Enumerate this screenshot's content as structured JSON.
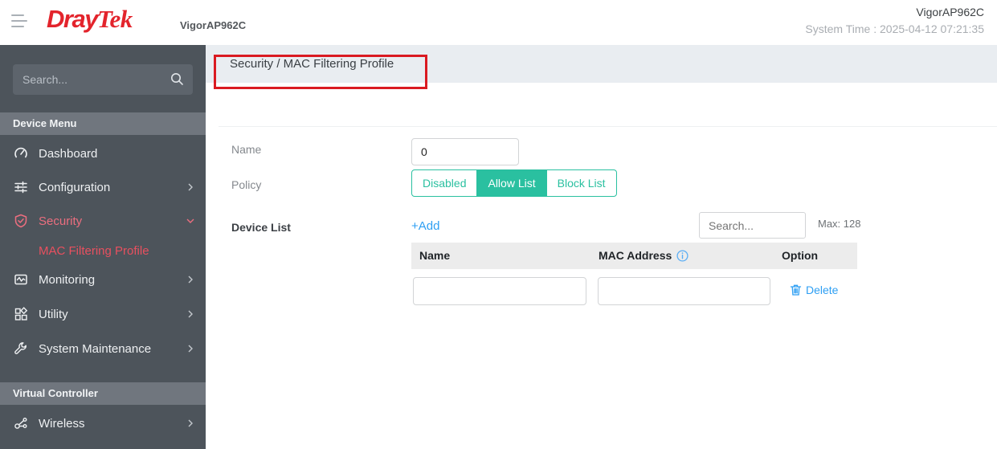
{
  "header": {
    "brand_dray": "Dray",
    "brand_tek": "Tek",
    "model_label": "VigorAP962C",
    "device_name": "VigorAP962C",
    "system_time": "System Time : 2025-04-12 07:21:35"
  },
  "sidebar": {
    "search_placeholder": "Search...",
    "device_menu_label": "Device Menu",
    "items": [
      {
        "label": "Dashboard"
      },
      {
        "label": "Configuration"
      },
      {
        "label": "Security"
      },
      {
        "label": "MAC Filtering Profile"
      },
      {
        "label": "Monitoring"
      },
      {
        "label": "Utility"
      },
      {
        "label": "System Maintenance"
      }
    ],
    "virtual_controller_label": "Virtual Controller",
    "wireless_label": "Wireless"
  },
  "breadcrumb": "Security / MAC Filtering Profile",
  "form": {
    "name_label": "Name",
    "name_value": "0",
    "policy_label": "Policy",
    "policy_options": [
      {
        "label": "Disabled",
        "selected": false
      },
      {
        "label": "Allow List",
        "selected": true
      },
      {
        "label": "Block List",
        "selected": false
      }
    ],
    "device_list_label": "Device List",
    "add_label": "+Add",
    "search_placeholder": "Search...",
    "max_label": "Max: 128",
    "table": {
      "col_name": "Name",
      "col_mac": "MAC Address",
      "col_option": "Option",
      "row_name_value": "",
      "row_mac_value": "",
      "delete_label": "Delete"
    }
  },
  "colors": {
    "brand_red": "#e3242c",
    "accent_teal": "#2ac0a0",
    "link_blue": "#2e9ff3",
    "sidebar_bg": "#4d545b",
    "sidebar_highlight_red": "#e8505f",
    "annotation_red": "#da1a21",
    "breadcrumb_band": "#e9edf1"
  }
}
